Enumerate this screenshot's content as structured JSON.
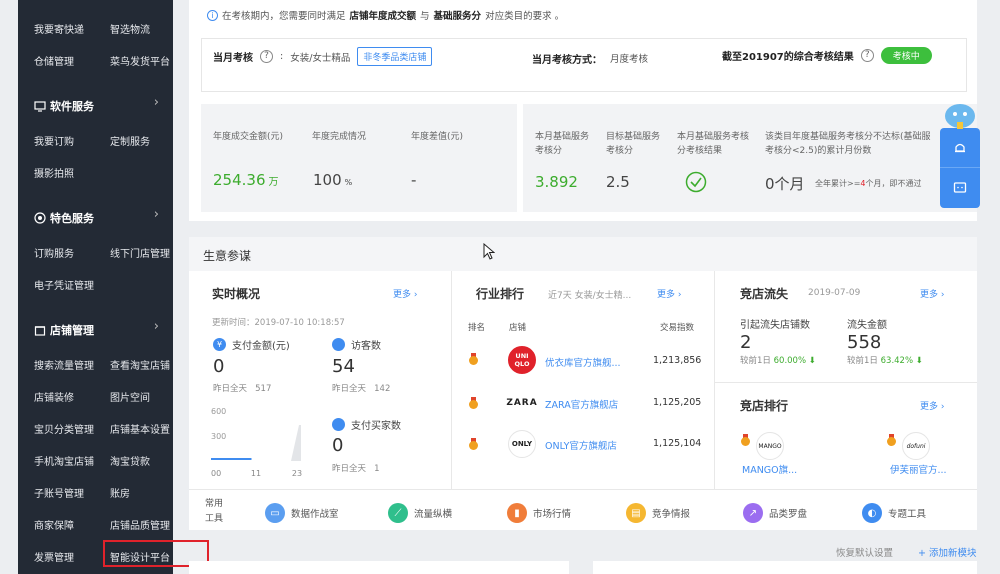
{
  "sidebar": {
    "rows": [
      {
        "left": "我要寄快递",
        "right": "智选物流"
      },
      {
        "left": "仓储管理",
        "right": "菜鸟发货平台"
      },
      {
        "left": "我要订购",
        "right": "定制服务"
      },
      {
        "left": "摄影拍照",
        "right": ""
      },
      {
        "left": "订购服务",
        "right": "线下门店管理"
      },
      {
        "left": "电子凭证管理",
        "right": ""
      },
      {
        "left": "搜索流量管理",
        "right": "查看淘宝店铺"
      },
      {
        "left": "店铺装修",
        "right": "图片空间"
      },
      {
        "left": "宝贝分类管理",
        "right": "店铺基本设置"
      },
      {
        "left": "手机淘宝店铺",
        "right": "淘宝贷款"
      },
      {
        "left": "子账号管理",
        "right": "账房"
      },
      {
        "left": "商家保障",
        "right": "店铺品质管理"
      },
      {
        "left": "发票管理",
        "right": "智能设计平台"
      }
    ],
    "headings": {
      "software": "软件服务",
      "special": "特色服务",
      "shop": "店铺管理"
    }
  },
  "assessment": {
    "notice_prefix": "在考核期内，您需要同时满足",
    "notice_strong1": "店铺年度成交额",
    "notice_mid": "与",
    "notice_strong2": "基础服务分",
    "notice_suffix": "对应类目的要求 。",
    "month_label": "当月考核",
    "month_category": "女装/女士精品",
    "category_tag": "非冬季品类店铺",
    "method_label": "当月考核方式：",
    "method_value": "月度考核",
    "result_label": "截至201907的综合考核结果",
    "result_pill": "考核中"
  },
  "annual": {
    "turnover_label": "年度成交金额(元)",
    "turnover_value": "254.36",
    "turnover_unit": "万",
    "completion_label": "年度完成情况",
    "completion_value": "100",
    "completion_unit": "%",
    "gap_label": "年度差值(元)",
    "gap_value": "-"
  },
  "basic": {
    "score_label_1": "本月基础服务",
    "score_label_2": "考核分",
    "score_value": "3.892",
    "target_label_1": "目标基础服务",
    "target_label_2": "考核分",
    "target_value": "2.5",
    "result_label_1": "本月基础服务考核",
    "result_label_2": "分考核结果",
    "below_label_1": "该类目年度基础服务考核分不达标(基础服",
    "below_label_2": "考核分<2.5)的累计月份数",
    "below_value": "0个月",
    "below_note_prefix": "全年累计>=",
    "below_note_num": "4",
    "below_note_suffix": "个月，即不通过"
  },
  "business": {
    "title": "生意参谋",
    "realtime": {
      "title": "实时概况",
      "more": "更多",
      "updated": "更新时间：2019-07-10 10:18:57",
      "pay_label": "支付金额(元)",
      "pay_value": "0",
      "pay_yesterday": "昨日全天",
      "pay_yesterday_value": "517",
      "visitors_label": "访客数",
      "visitors_value": "54",
      "visitors_yesterday": "昨日全天",
      "visitors_yesterday_value": "142",
      "buyers_label": "支付买家数",
      "buyers_value": "0",
      "buyers_yesterday": "昨日全天",
      "buyers_yesterday_value": "1"
    },
    "industry": {
      "title": "行业排行",
      "subtitle": "近7天 女装/女士精...",
      "more": "更多",
      "col_rank": "排名",
      "col_shop": "店铺",
      "col_index": "交易指数",
      "rows": [
        {
          "logo": "UNI QLO",
          "name": "优衣库官方旗舰...",
          "index": "1,213,856"
        },
        {
          "logo": "ZARA",
          "name": "ZARA官方旗舰店",
          "index": "1,125,205"
        },
        {
          "logo": "ONLY",
          "name": "ONLY官方旗舰店",
          "index": "1,125,104"
        }
      ]
    },
    "churn": {
      "title": "竞店流失",
      "date": "2019-07-09",
      "more": "更多",
      "shops_label": "引起流失店铺数",
      "shops_value": "2",
      "shops_compare": "较前1日",
      "shops_pct": "60.00%",
      "amount_label": "流失金额",
      "amount_value": "558",
      "amount_compare": "较前1日",
      "amount_pct": "63.42%"
    },
    "comp_rank": {
      "title": "竞店排行",
      "more": "更多",
      "shops": [
        {
          "logo": "MANGO",
          "name": "MANGO旗..."
        },
        {
          "logo": "dofuni",
          "name": "伊芙丽官方..."
        }
      ]
    },
    "tools": {
      "label_1": "常用",
      "label_2": "工具",
      "items": [
        {
          "name": "数据作战室",
          "color": "#5b9ef0"
        },
        {
          "name": "流量纵横",
          "color": "#2fbf8c"
        },
        {
          "name": "市场行情",
          "color": "#f07d3a"
        },
        {
          "name": "竞争情报",
          "color": "#f5b731"
        },
        {
          "name": "品类罗盘",
          "color": "#9b6df0"
        },
        {
          "name": "专题工具",
          "color": "#3f8cf0"
        }
      ]
    }
  },
  "chart_data": {
    "type": "line",
    "x": [
      "00",
      "11",
      "23"
    ],
    "yticks": [
      "600",
      "300",
      "0"
    ],
    "ylim": [
      0,
      600
    ],
    "series": [
      {
        "values": [
          0,
          0,
          0,
          0,
          0,
          0,
          0,
          0,
          0,
          0,
          0,
          0,
          0,
          0,
          0,
          0,
          0,
          0,
          0,
          0,
          0,
          0,
          0,
          0
        ]
      }
    ]
  },
  "footer": {
    "restore": "恢复默认设置",
    "add_module": "+ 添加新模块"
  }
}
